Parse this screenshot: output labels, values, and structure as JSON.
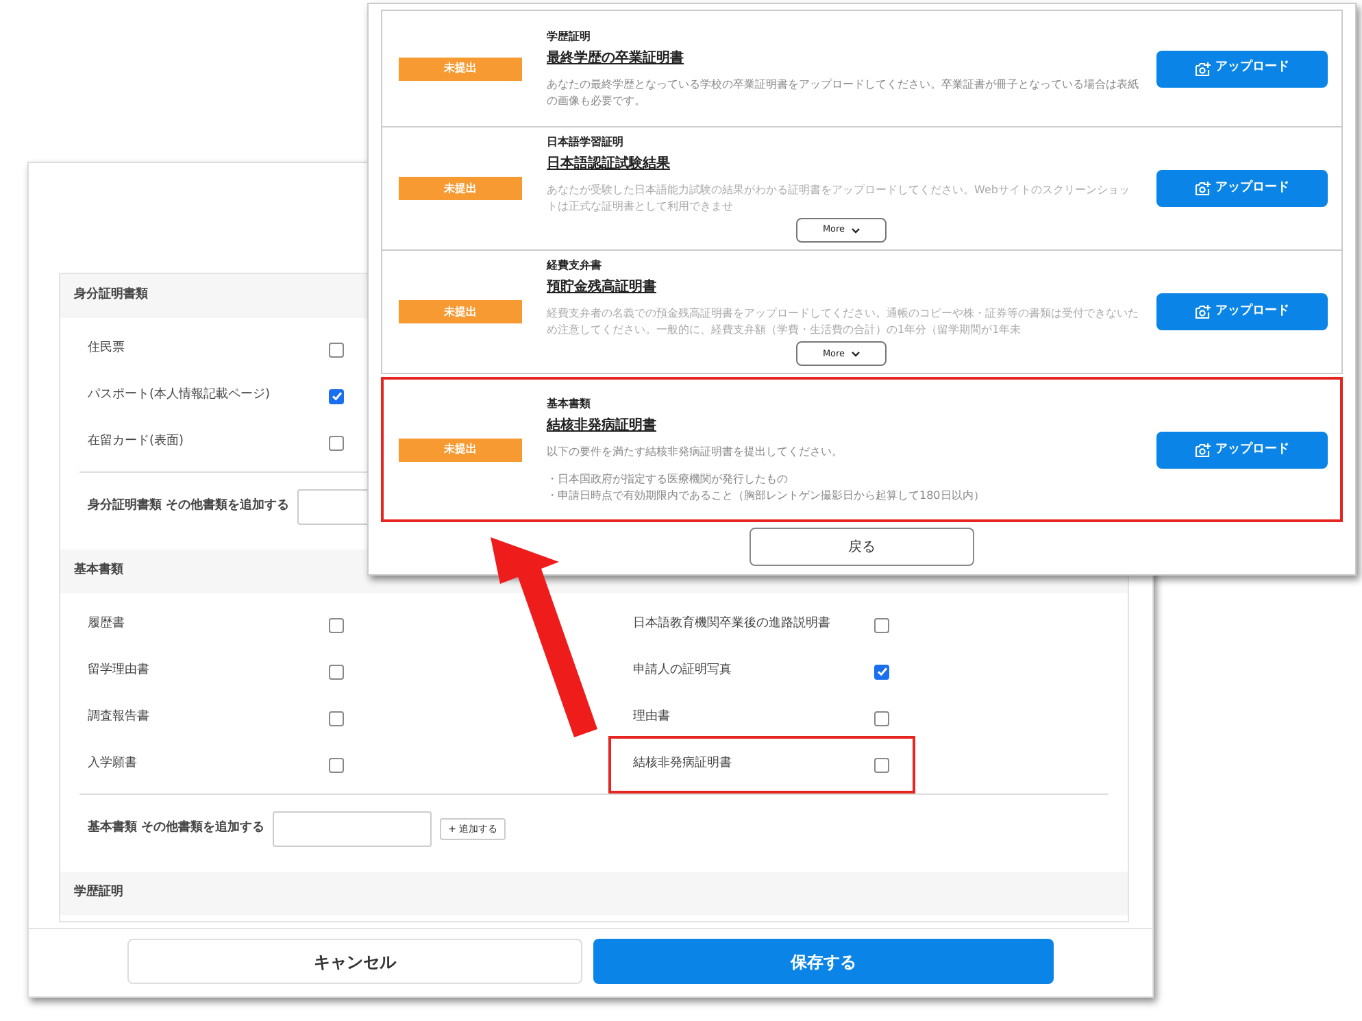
{
  "form_window": {
    "sections": [
      {
        "title": "身分証明書類",
        "columns": [
          [
            {
              "label": "住民票",
              "checked": false,
              "highlighted": false
            },
            {
              "label": "パスポート(本人情報記載ページ)",
              "checked": true,
              "highlighted": false
            },
            {
              "label": "在留カード(表面)",
              "checked": false,
              "highlighted": false
            }
          ],
          []
        ],
        "add_label": "身分証明書類 その他書類を追加する"
      },
      {
        "title": "基本書類",
        "columns": [
          [
            {
              "label": "履歴書",
              "checked": false,
              "highlighted": false
            },
            {
              "label": "留学理由書",
              "checked": false,
              "highlighted": false
            },
            {
              "label": "調査報告書",
              "checked": false,
              "highlighted": false
            },
            {
              "label": "入学願書",
              "checked": false,
              "highlighted": false
            }
          ],
          [
            {
              "label": "日本語教育機関卒業後の進路説明書",
              "checked": false,
              "highlighted": false
            },
            {
              "label": "申請人の証明写真",
              "checked": true,
              "highlighted": false
            },
            {
              "label": "理由書",
              "checked": false,
              "highlighted": false
            },
            {
              "label": "結核非発病証明書",
              "checked": false,
              "highlighted": true
            }
          ]
        ],
        "add_label": "基本書類 その他書類を追加する",
        "add_button": "+ 追加する"
      },
      {
        "title": "学歴証明"
      }
    ],
    "cancel_button": "キャンセル",
    "save_button": "保存する"
  },
  "upload_window": {
    "items": [
      {
        "status": "未提出",
        "category": "学歴証明",
        "title": "最終学歴の卒業証明書",
        "description": [
          "あなたの最終学歴となっている学校の卒業証明書をアップロードしてください。卒業証書が冊子となっている場合は表紙の画像も必要です。"
        ],
        "collapsed": false,
        "highlighted": false,
        "upload_button": "アップロード"
      },
      {
        "status": "未提出",
        "category": "日本語学習証明",
        "title": "日本語認証試験結果",
        "description": [
          "あなたが受験した日本語能力試験の結果がわかる証明書をアップロードしてください。Webサイトのスクリーンショットは正式な証明書として利用できませ"
        ],
        "collapsed": true,
        "more_button": "More",
        "highlighted": false,
        "upload_button": "アップロード"
      },
      {
        "status": "未提出",
        "category": "経費支弁書",
        "title": "預貯金残高証明書",
        "description": [
          "経費支弁者の名義での預金残高証明書をアップロードしてください。通帳のコピーや株・証券等の書類は受付できないため注意してください。一般的に、経費支弁額（学費・生活費の合計）の1年分（留学期間が1年未"
        ],
        "collapsed": true,
        "more_button": "More",
        "highlighted": false,
        "upload_button": "アップロード"
      },
      {
        "status": "未提出",
        "category": "基本書類",
        "title": "結核非発病証明書",
        "description": [
          "以下の要件を満たす結核非発病証明書を提出してください。",
          "・日本国政府が指定する医療機関が発行したもの",
          "・申請日時点で有効期限内であること（胸部レントゲン撮影日から起算して180日以内）"
        ],
        "collapsed": false,
        "highlighted": true,
        "upload_button": "アップロード"
      }
    ],
    "back_button": "戻る"
  }
}
